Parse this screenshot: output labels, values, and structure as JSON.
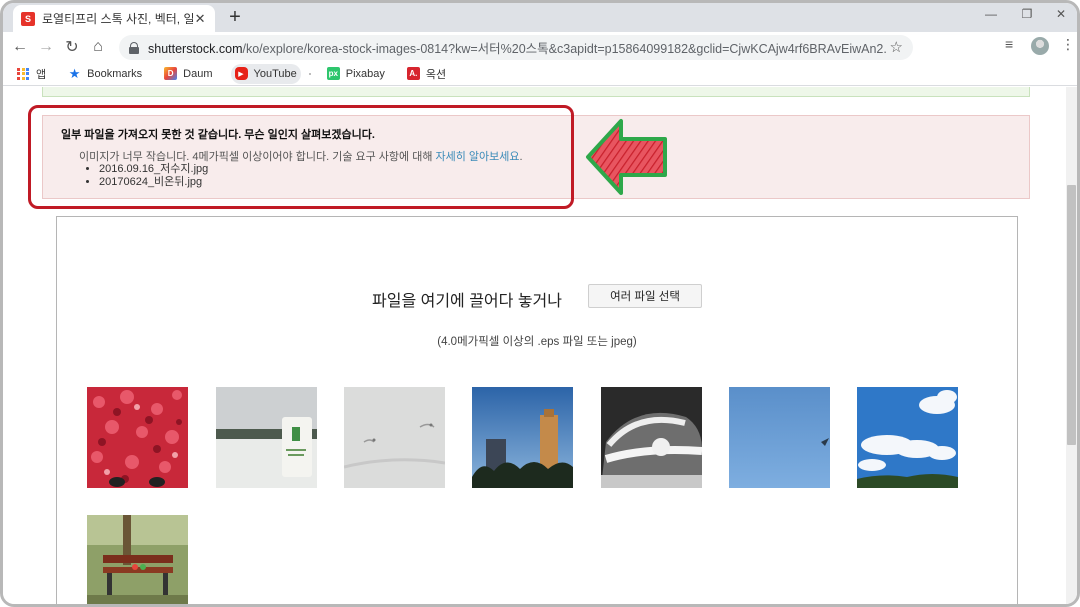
{
  "browser": {
    "tab_title": "로열티프리 스톡 사진, 벡터, 일러",
    "tab_close": "✕",
    "new_tab": "+",
    "url_host": "shutterstock.com",
    "url_path": "/ko/explore/korea-stock-images-0814?kw=서터%20스톡&c3apidt=p15864099182&gclid=CjwKCAjw4rf6BRAvEiwAn2...",
    "bookmarks": [
      {
        "label": "앱",
        "icon": "apps-grid-icon"
      },
      {
        "label": "Bookmarks",
        "icon": "star-icon"
      },
      {
        "label": "Daum",
        "icon": "daum-icon"
      },
      {
        "label": "YouTube",
        "icon": "youtube-icon"
      },
      {
        "label": "Pixabay",
        "icon": "pixabay-icon"
      },
      {
        "label": "옥션",
        "icon": "auction-icon"
      }
    ]
  },
  "error": {
    "title": "일부 파일을 가져오지 못한 것 같습니다. 무슨 일인지 살펴보겠습니다.",
    "message": "이미지가 너무 작습니다. 4메가픽셀 이상이어야 합니다. 기술 요구 사항에 대해 ",
    "link": "자세히 알아보세요",
    "period": ".",
    "files": [
      "2016.09.16_저수지.jpg",
      "20170624_비온뒤.jpg"
    ]
  },
  "upload": {
    "title": "파일을 여기에 끌어다 놓거나",
    "button": "여러 파일 선택",
    "subtitle": "(4.0메가픽셀 이상의 .eps 파일 또는 jpeg)"
  },
  "colors": {
    "highlight": "#c01a25",
    "arrow_fill": "#e03a45",
    "arrow_stroke": "#2ea84a",
    "link": "#3a8ab8"
  }
}
